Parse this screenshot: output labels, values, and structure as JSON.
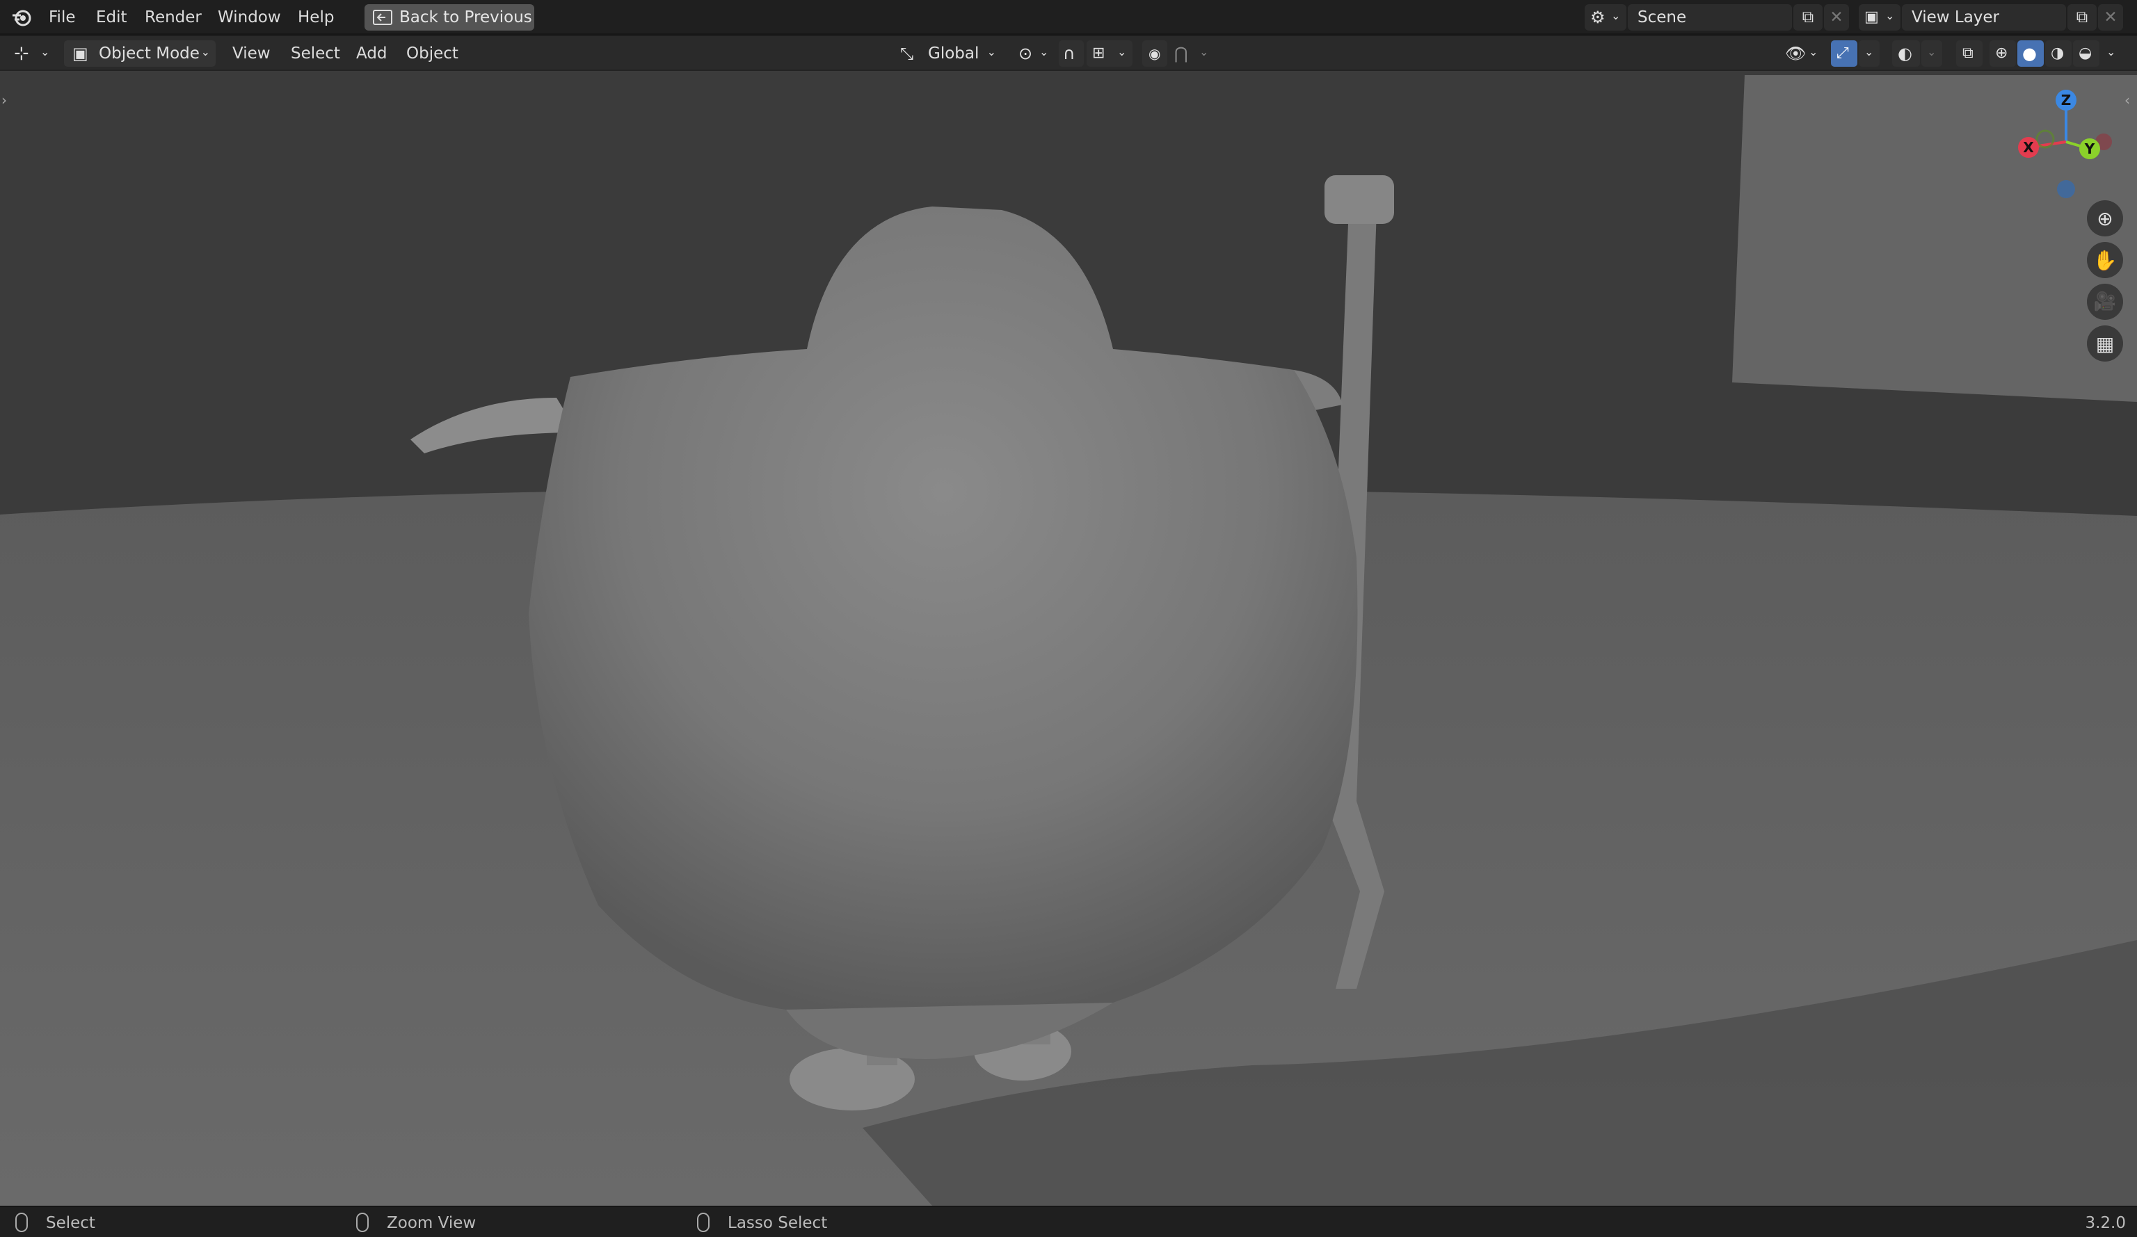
{
  "topbar": {
    "menus": [
      "File",
      "Edit",
      "Render",
      "Window",
      "Help"
    ],
    "back_button": "Back to Previous",
    "scene": "Scene",
    "view_layer": "View Layer"
  },
  "header": {
    "mode": "Object Mode",
    "menus": [
      "View",
      "Select",
      "Add",
      "Object"
    ],
    "orientation": "Global"
  },
  "gizmo": {
    "x": "X",
    "y": "Y",
    "z": "Z"
  },
  "status": {
    "select": "Select",
    "zoom": "Zoom View",
    "lasso": "Lasso Select",
    "version": "3.2.0"
  },
  "colors": {
    "accent": "#4772b3",
    "x_axis": "#e33c4f",
    "y_axis": "#8bd12a",
    "z_axis": "#3b88e3"
  }
}
